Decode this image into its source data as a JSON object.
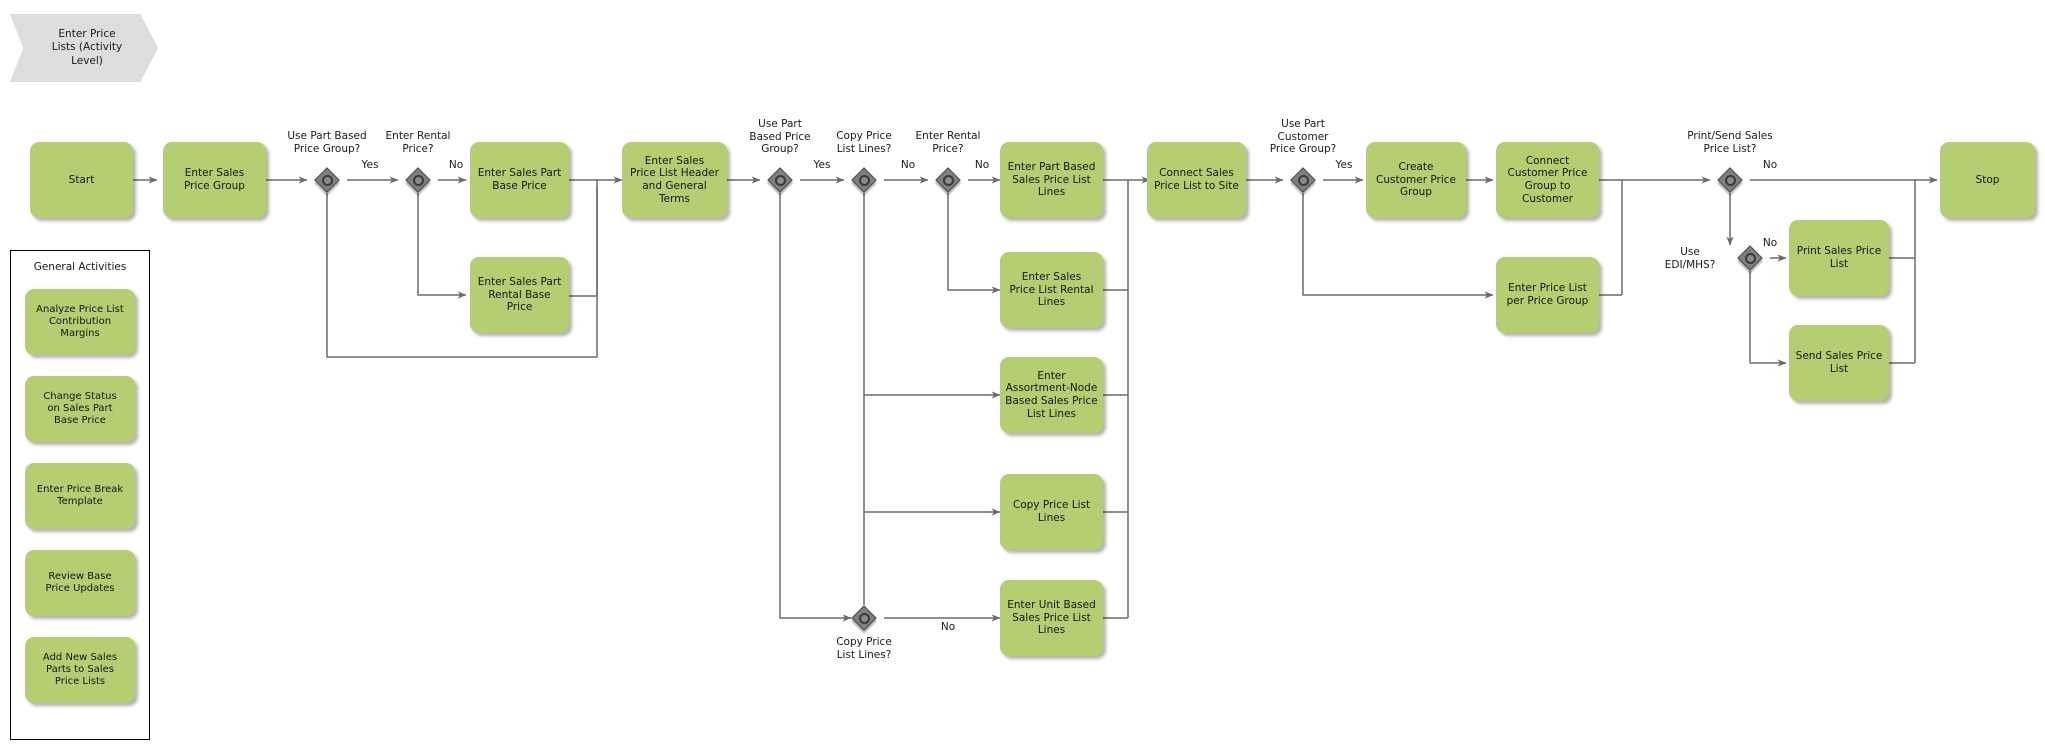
{
  "diagram": {
    "title": "Enter Price Lists (Activity Level)",
    "type": "flowchart",
    "colors": {
      "task_fill": "#b5ce72",
      "banner_fill": "#dddddd",
      "gateway_fill": "#7f7f7f",
      "connector": "#6b6b6b",
      "text": "#1a1a1a"
    }
  },
  "banner": {
    "label": "Enter Price\nLists (Activity\nLevel)"
  },
  "panel": {
    "title": "General Activities",
    "items": [
      {
        "label": "Analyze Price List\nContribution\nMargins"
      },
      {
        "label": "Change Status\non Sales Part\nBase Price"
      },
      {
        "label": "Enter Price Break\nTemplate"
      },
      {
        "label": "Review Base\nPrice Updates"
      },
      {
        "label": "Add New Sales\nParts to Sales\nPrice Lists"
      }
    ]
  },
  "tasks": [
    {
      "id": "start",
      "label": "Start"
    },
    {
      "id": "enter_spg",
      "label": "Enter Sales\nPrice Group"
    },
    {
      "id": "sp_base",
      "label": "Enter Sales Part\nBase Price"
    },
    {
      "id": "sp_rental_base",
      "label": "Enter Sales Part\nRental Base\nPrice"
    },
    {
      "id": "pl_header",
      "label": "Enter Sales\nPrice List Header\nand General\nTerms"
    },
    {
      "id": "part_based_lines",
      "label": "Enter Part Based\nSales Price List\nLines"
    },
    {
      "id": "rental_lines",
      "label": "Enter Sales\nPrice List Rental\nLines"
    },
    {
      "id": "assort_lines",
      "label": "Enter\nAssortment-Node\nBased Sales Price\nList Lines"
    },
    {
      "id": "copy_lines",
      "label": "Copy Price List\nLines"
    },
    {
      "id": "unit_lines",
      "label": "Enter Unit Based\nSales Price List\nLines"
    },
    {
      "id": "connect_site",
      "label": "Connect Sales\nPrice List to Site"
    },
    {
      "id": "create_cpg",
      "label": "Create\nCustomer Price\nGroup"
    },
    {
      "id": "connect_cpg",
      "label": "Connect\nCustomer Price\nGroup to\nCustomer"
    },
    {
      "id": "pl_per_pg",
      "label": "Enter Price List\nper Price Group"
    },
    {
      "id": "print_spl",
      "label": "Print Sales Price\nList"
    },
    {
      "id": "send_spl",
      "label": "Send Sales Price\nList"
    },
    {
      "id": "stop",
      "label": "Stop"
    }
  ],
  "gateways": [
    {
      "id": "gw_part_based_pg",
      "label": "Use Part Based\nPrice Group?"
    },
    {
      "id": "gw_rental_price_1",
      "label": "Enter Rental\nPrice?"
    },
    {
      "id": "gw_part_based_pg_2",
      "label": "Use Part\nBased Price\nGroup?"
    },
    {
      "id": "gw_copy_lines_1",
      "label": "Copy Price\nList Lines?"
    },
    {
      "id": "gw_rental_price_2",
      "label": "Enter Rental\nPrice?"
    },
    {
      "id": "gw_copy_lines_2",
      "label": "Copy Price\nList Lines?"
    },
    {
      "id": "gw_cust_pg",
      "label": "Use Part\nCustomer\nPrice Group?"
    },
    {
      "id": "gw_print_send",
      "label": "Print/Send Sales\nPrice List?"
    },
    {
      "id": "gw_edi_mhs",
      "label": "Use\nEDI/MHS?"
    }
  ],
  "edge_labels": [
    {
      "id": "e1",
      "text": "Yes"
    },
    {
      "id": "e2",
      "text": "No"
    },
    {
      "id": "e3",
      "text": "Yes"
    },
    {
      "id": "e4",
      "text": "No"
    },
    {
      "id": "e5",
      "text": "No"
    },
    {
      "id": "e6",
      "text": "No"
    },
    {
      "id": "e7",
      "text": "Yes"
    },
    {
      "id": "e8",
      "text": "No"
    },
    {
      "id": "e9",
      "text": "No"
    }
  ]
}
